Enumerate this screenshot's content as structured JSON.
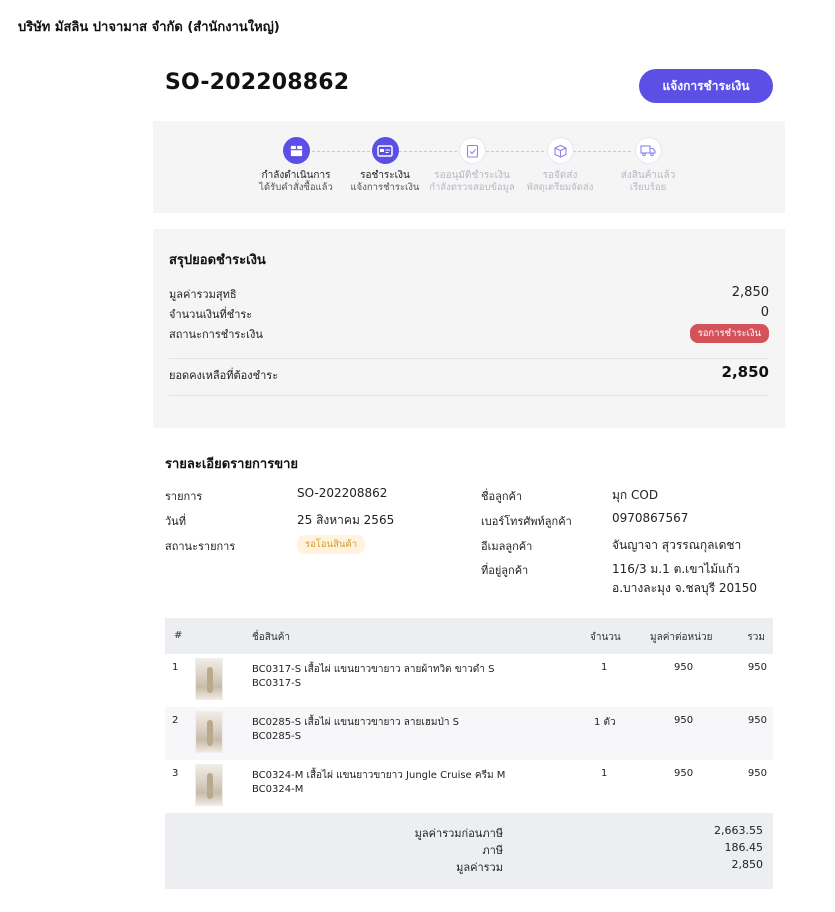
{
  "company": "บริษัท มัสลิน ปาจามาส จำกัด (สำนักงานใหญ่)",
  "order_number": "SO-202208862",
  "pay_button": "แจ้งการชำระเงิน",
  "steps": [
    {
      "title": "กำลังดำเนินการ",
      "subtitle": "ได้รับคำสั่งซื้อแล้ว",
      "icon": "box-icon",
      "active": true
    },
    {
      "title": "รอชำระเงิน",
      "subtitle": "แจ้งการชำระเงิน",
      "icon": "payment-card-icon",
      "active": true
    },
    {
      "title": "รออนุมัติชำระเงิน",
      "subtitle": "กำลังตรวจสอบข้อมูล",
      "icon": "clipboard-check-icon",
      "active": false
    },
    {
      "title": "รอจัดส่ง",
      "subtitle": "พัสดุเตรียมจัดส่ง",
      "icon": "package-icon",
      "active": false
    },
    {
      "title": "ส่งสินค้าแล้ว",
      "subtitle": "เรียบร้อย",
      "icon": "truck-icon",
      "active": false
    }
  ],
  "summary": {
    "title": "สรุปยอดชำระเงิน",
    "net_label": "มูลค่ารวมสุทธิ",
    "net_value": "2,850",
    "paid_label": "จำนวนเงินที่ชำระ",
    "paid_value": "0",
    "status_label": "สถานะการชำระเงิน",
    "status_value": "รอการชำระเงิน",
    "balance_label": "ยอดคงเหลือที่ต้องชำระ",
    "balance_value": "2,850"
  },
  "details": {
    "title": "รายละเอียดรายการขาย",
    "item_label": "รายการ",
    "item_value": "SO-202208862",
    "date_label": "วันที่",
    "date_value": "25 สิงหาคม 2565",
    "status_label": "สถานะรายการ",
    "status_value": "รอโอนสินค้า",
    "customer_label": "ชื่อลูกค้า",
    "customer_value": "มุก COD",
    "phone_label": "เบอร์โทรศัพท์ลูกค้า",
    "phone_value": "0970867567",
    "email_label": "อีเมลลูกค้า",
    "email_value": "จันญาจา สุวรรณกุลเดชา",
    "address_label": "ที่อยู่ลูกค้า",
    "address_line1": "116/3 ม.1 ต.เขาไม้แก้ว",
    "address_line2": "อ.บางละมุง จ.ชลบุรี 20150"
  },
  "table": {
    "headers": {
      "num": "#",
      "name": "ชื่อสินค้า",
      "qty": "จำนวน",
      "unit": "มูลค่าต่อหน่วย",
      "total": "รวม"
    },
    "rows": [
      {
        "num": "1",
        "name": "BC0317-S เสื้อไผ่ แขนยาวขายาว ลายผ้าทวิต ขาวดำ S",
        "sku": "BC0317-S",
        "qty": "1",
        "unit": "950",
        "total": "950"
      },
      {
        "num": "2",
        "name": "BC0285-S เสื้อไผ่ แขนยาวขายาว ลายเฮมป่า S",
        "sku": "BC0285-S",
        "qty": "1 ตัว",
        "unit": "950",
        "total": "950"
      },
      {
        "num": "3",
        "name": "BC0324-M เสื้อไผ่ แขนยาวขายาว Jungle Cruise ครีม M",
        "sku": "BC0324-M",
        "qty": "1",
        "unit": "950",
        "total": "950"
      }
    ],
    "footer": {
      "subtotal_label": "มูลค่ารวมก่อนภาษี",
      "subtotal_value": "2,663.55",
      "tax_label": "ภาษี",
      "tax_value": "186.45",
      "total_label": "มูลค่ารวม",
      "total_value": "2,850"
    }
  },
  "colors": {
    "accent": "#5b4fe6",
    "status_red": "#d4535a",
    "status_yellow": "#d19a2a"
  }
}
